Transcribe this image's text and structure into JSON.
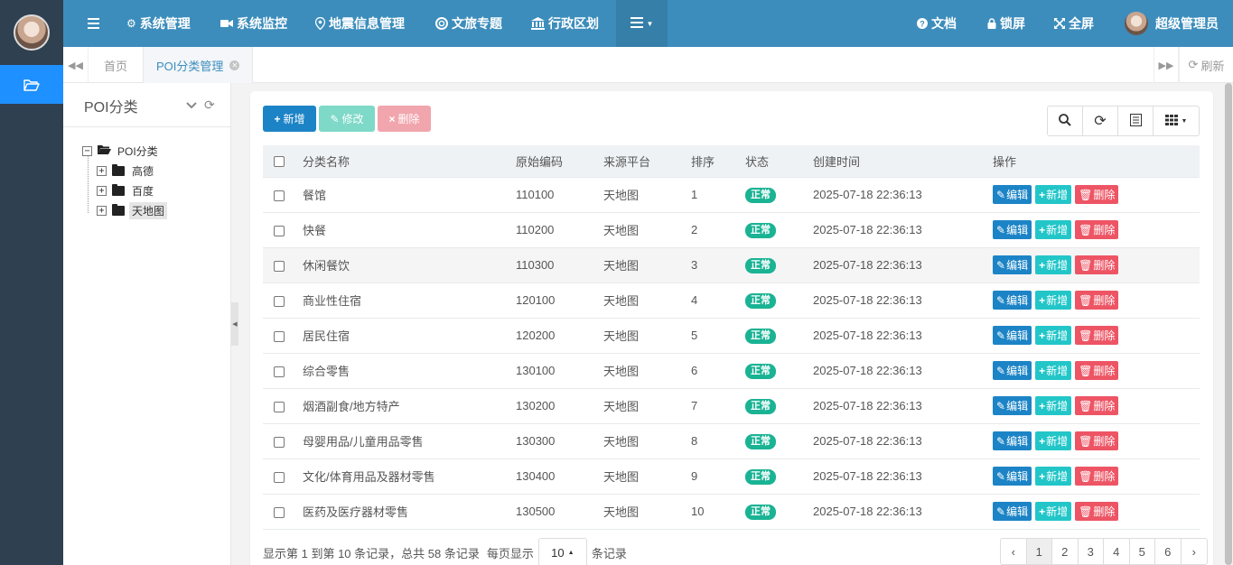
{
  "topnav": {
    "items": [
      {
        "label": "系统管理",
        "icon": "gear-icon"
      },
      {
        "label": "系统监控",
        "icon": "video-camera-icon"
      },
      {
        "label": "地震信息管理",
        "icon": "map-pin-icon"
      },
      {
        "label": "文旅专题",
        "icon": "life-ring-icon"
      },
      {
        "label": "行政区划",
        "icon": "bank-icon"
      }
    ],
    "docs": "文档",
    "lock": "锁屏",
    "fullscreen": "全屏",
    "user": "超级管理员"
  },
  "tabs": {
    "home": "首页",
    "active": "POI分类管理",
    "refresh": "刷新"
  },
  "tree": {
    "title": "POI分类",
    "root": "POI分类",
    "children": [
      "高德",
      "百度",
      "天地图"
    ],
    "selected": "天地图"
  },
  "toolbar": {
    "add": "新增",
    "edit": "修改",
    "delete": "删除"
  },
  "table": {
    "headers": [
      "分类名称",
      "原始编码",
      "来源平台",
      "排序",
      "状态",
      "创建时间",
      "操作"
    ],
    "row_actions": {
      "edit": "编辑",
      "add": "新增",
      "delete": "删除"
    },
    "rows": [
      {
        "name": "餐馆",
        "code": "110100",
        "platform": "天地图",
        "sort": "1",
        "status": "正常",
        "time": "2025-07-18 22:36:13"
      },
      {
        "name": "快餐",
        "code": "110200",
        "platform": "天地图",
        "sort": "2",
        "status": "正常",
        "time": "2025-07-18 22:36:13"
      },
      {
        "name": "休闲餐饮",
        "code": "110300",
        "platform": "天地图",
        "sort": "3",
        "status": "正常",
        "time": "2025-07-18 22:36:13"
      },
      {
        "name": "商业性住宿",
        "code": "120100",
        "platform": "天地图",
        "sort": "4",
        "status": "正常",
        "time": "2025-07-18 22:36:13"
      },
      {
        "name": "居民住宿",
        "code": "120200",
        "platform": "天地图",
        "sort": "5",
        "status": "正常",
        "time": "2025-07-18 22:36:13"
      },
      {
        "name": "综合零售",
        "code": "130100",
        "platform": "天地图",
        "sort": "6",
        "status": "正常",
        "time": "2025-07-18 22:36:13"
      },
      {
        "name": "烟酒副食/地方特产",
        "code": "130200",
        "platform": "天地图",
        "sort": "7",
        "status": "正常",
        "time": "2025-07-18 22:36:13"
      },
      {
        "name": "母婴用品/儿童用品零售",
        "code": "130300",
        "platform": "天地图",
        "sort": "8",
        "status": "正常",
        "time": "2025-07-18 22:36:13"
      },
      {
        "name": "文化/体育用品及器材零售",
        "code": "130400",
        "platform": "天地图",
        "sort": "9",
        "status": "正常",
        "time": "2025-07-18 22:36:13"
      },
      {
        "name": "医药及医疗器材零售",
        "code": "130500",
        "platform": "天地图",
        "sort": "10",
        "status": "正常",
        "time": "2025-07-18 22:36:13"
      }
    ]
  },
  "pager": {
    "info": "显示第 1 到第 10 条记录，总共 58 条记录",
    "per_page_prefix": "每页显示",
    "page_size": "10",
    "per_page_suffix": "条记录",
    "prev": "‹",
    "pages": [
      "1",
      "2",
      "3",
      "4",
      "5",
      "6"
    ],
    "current": "1",
    "next": "›"
  },
  "colors": {
    "topbar": "#3c8dbc",
    "sidebar": "#2f4050",
    "primary": "#1c84c6",
    "success": "#1ab394",
    "info": "#23c6c8",
    "danger": "#ed5565"
  }
}
